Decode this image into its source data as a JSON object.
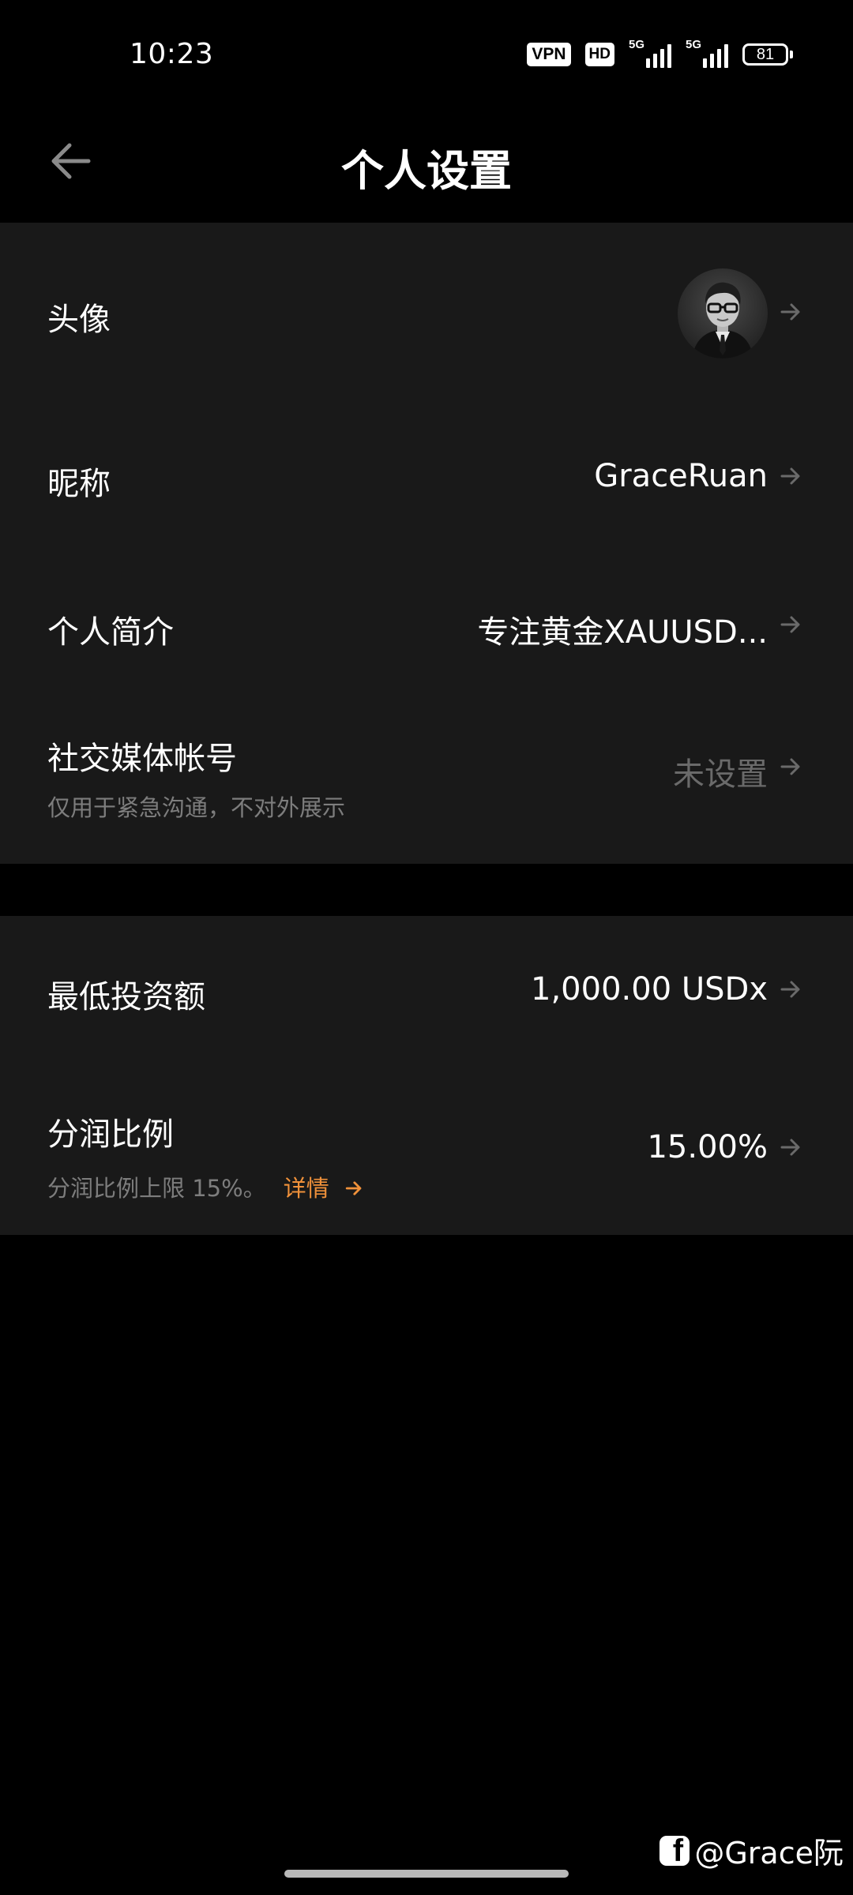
{
  "status_bar": {
    "time": "10:23",
    "vpn": "VPN",
    "hd": "HD",
    "net1": "5G",
    "net2": "5G",
    "battery": "81"
  },
  "header": {
    "title": "个人设置",
    "back_icon": "arrow-left-icon"
  },
  "profile": {
    "avatar_label": "头像",
    "nickname_label": "昵称",
    "nickname_value": "GraceRuan",
    "bio_label": "个人简介",
    "bio_value": "专注黄金XAUUSD...",
    "social_label": "社交媒体帐号",
    "social_sub": "仅用于紧急沟通，不对外展示",
    "social_value": "未设置"
  },
  "investment": {
    "min_label": "最低投资额",
    "min_value": "1,000.00 USDx",
    "share_label": "分润比例",
    "share_sub": "分润比例上限 15%。",
    "share_link": "详情",
    "share_value": "15.00%"
  },
  "watermark": "@Grace阮",
  "colors": {
    "background": "#000000",
    "card": "#191919",
    "accent": "#f0913a",
    "muted_text": "#7d7d7d"
  }
}
